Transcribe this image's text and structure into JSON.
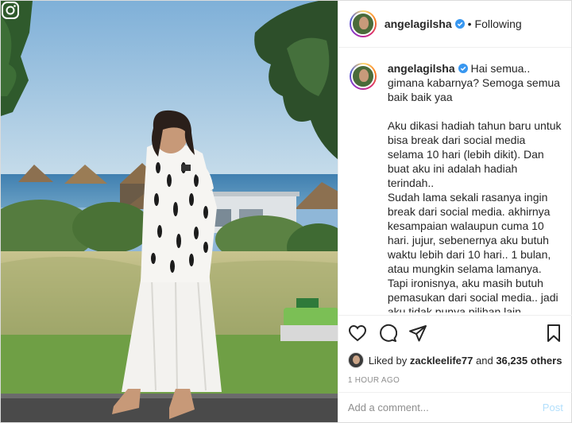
{
  "post": {
    "username": "angelagilsha",
    "verified": true,
    "follow_status": "Following",
    "separator": "•",
    "caption": "Hai semua.. gimana kabarnya? Semoga semua baik baik yaa\n\nAku dikasi hadiah tahun baru untuk bisa break dari social media selama 10 hari (lebih dikit). Dan buat aku ini adalah hadiah terindah..\nSudah lama sekali rasanya ingin break dari social media. akhirnya kesampaian walaupun cuma 10 hari. jujur, sebenernya aku butuh waktu lebih dari 10 hari.. 1 bulan, atau mungkin selama lamanya. Tapi ironisnya, aku masih butuh pemasukan dari social media.. jadi aku tidak punya pilihan lain.\nSekarang aku ngerti hal apa saja yang ternyata selama ini menjadi beban buat aku",
    "likes": {
      "prefix": "Liked by",
      "user": "zackleelife77",
      "connector": "and",
      "others": "36,235 others"
    },
    "time_ago": "1 HOUR AGO"
  },
  "comment": {
    "placeholder": "Add a comment...",
    "post_label": "Post"
  },
  "icons": {
    "like": "heart-icon",
    "comment": "comment-icon",
    "share": "share-icon",
    "save": "bookmark-icon",
    "verified": "verified-badge-icon",
    "watermark": "instagram-logo-icon"
  },
  "colors": {
    "verified_blue": "#3897f0",
    "post_button_disabled": "#b2dffc",
    "muted_text": "#8e8e8e",
    "border": "#efefef"
  }
}
